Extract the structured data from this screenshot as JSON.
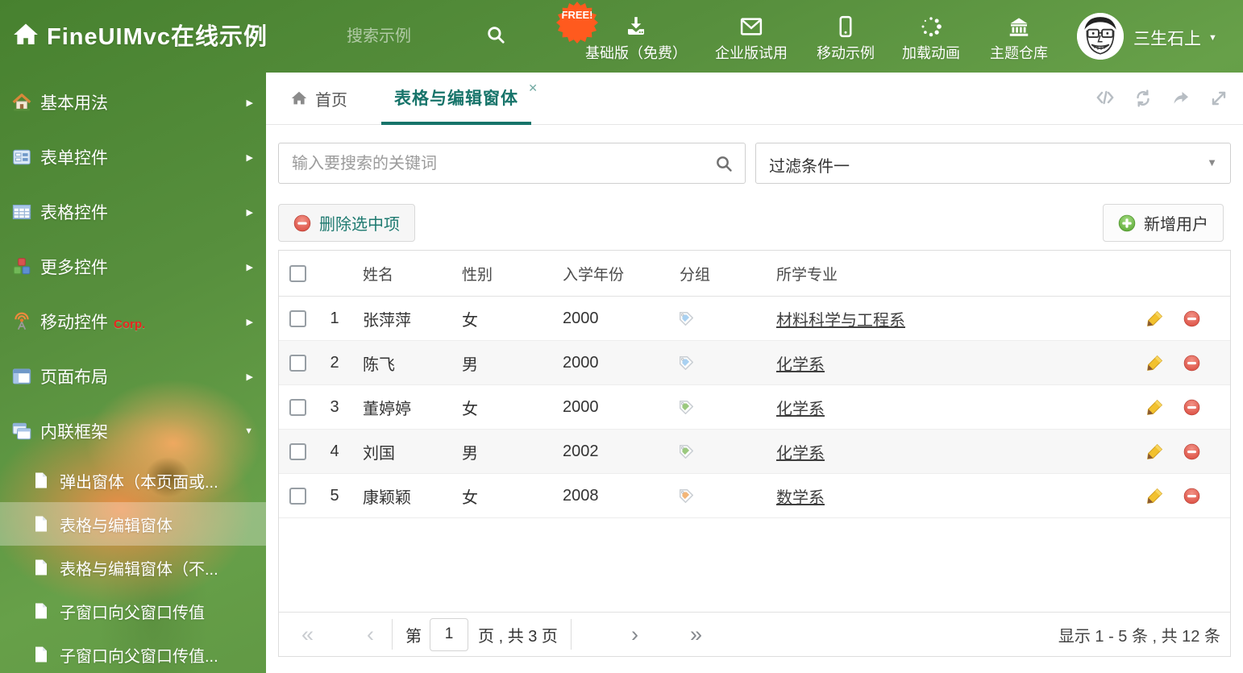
{
  "header": {
    "title": "FineUIMvc在线示例",
    "search_placeholder": "搜索示例",
    "free_badge": "FREE!",
    "nav": [
      {
        "label": "基础版（免费）"
      },
      {
        "label": "企业版试用"
      },
      {
        "label": "移动示例"
      },
      {
        "label": "加载动画"
      },
      {
        "label": "主题仓库"
      }
    ],
    "user": {
      "name": "三生石上"
    }
  },
  "sidebar": {
    "items": [
      {
        "label": "基本用法"
      },
      {
        "label": "表单控件"
      },
      {
        "label": "表格控件"
      },
      {
        "label": "更多控件"
      },
      {
        "label": "移动控件",
        "badge": "Corp."
      },
      {
        "label": "页面布局"
      },
      {
        "label": "内联框架"
      }
    ],
    "subitems": [
      {
        "label": "弹出窗体（本页面或..."
      },
      {
        "label": "表格与编辑窗体"
      },
      {
        "label": "表格与编辑窗体（不..."
      },
      {
        "label": "子窗口向父窗口传值"
      },
      {
        "label": "子窗口向父窗口传值..."
      }
    ]
  },
  "tabs": {
    "home": "首页",
    "active": "表格与编辑窗体",
    "close": "✕"
  },
  "search": {
    "placeholder": "输入要搜索的关键词"
  },
  "filter": {
    "value": "过滤条件一"
  },
  "toolbar": {
    "delete": "删除选中项",
    "add": "新增用户"
  },
  "grid": {
    "headers": {
      "name": "姓名",
      "gender": "性别",
      "year": "入学年份",
      "group": "分组",
      "major": "所学专业"
    },
    "rows": [
      {
        "num": "1",
        "name": "张萍萍",
        "gender": "女",
        "year": "2000",
        "tag_color": "#a9d1f1",
        "major": "材料科学与工程系"
      },
      {
        "num": "2",
        "name": "陈飞",
        "gender": "男",
        "year": "2000",
        "tag_color": "#a9d1f1",
        "major": "化学系"
      },
      {
        "num": "3",
        "name": "董婷婷",
        "gender": "女",
        "year": "2000",
        "tag_color": "#9bc97f",
        "major": "化学系"
      },
      {
        "num": "4",
        "name": "刘国",
        "gender": "男",
        "year": "2002",
        "tag_color": "#9bc97f",
        "major": "化学系"
      },
      {
        "num": "5",
        "name": "康颖颖",
        "gender": "女",
        "year": "2008",
        "tag_color": "#f3b577",
        "major": "数学系"
      }
    ]
  },
  "pagination": {
    "page_prefix": "第",
    "page": "1",
    "page_suffix": "页 , 共 3 页",
    "summary": "显示 1 - 5 条 , 共 12 条"
  },
  "colors": {
    "accent": "#17746a",
    "free_badge": "#ff5a1e",
    "corp_red": "#e8261f",
    "delete_icon": "#d9463a",
    "add_icon": "#55a42e"
  }
}
